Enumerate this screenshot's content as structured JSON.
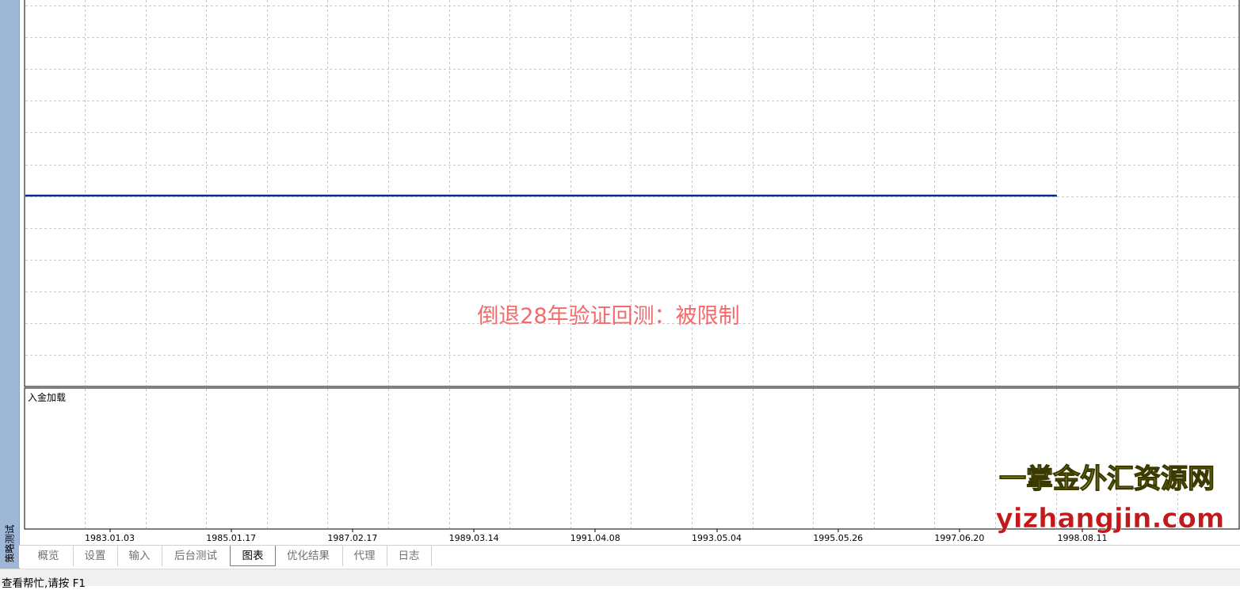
{
  "window": {
    "side_title": "策略测试"
  },
  "chart": {
    "overlay_text": "倒退28年验证回测：被限制",
    "subpanel_label": "入金加载",
    "watermark_cn": "一掌金外汇资源网",
    "watermark_url": "yizhangjin.com",
    "line_color": "#0a2a8a",
    "overlay_color": "#f26a6a",
    "watermark_fill": "#e9f23c"
  },
  "chart_data": {
    "type": "line",
    "x_tick_labels": [
      "1983.01.03",
      "1985.01.17",
      "1987.02.17",
      "1989.03.14",
      "1991.04.08",
      "1993.05.04",
      "1995.05.26",
      "1997.06.20",
      "1998.08.11"
    ],
    "series": [
      {
        "x": [
          "1983.01.03",
          "1998.08.11"
        ],
        "y": [
          1,
          1
        ]
      }
    ],
    "grid": true
  },
  "tabs": [
    {
      "label": "概览",
      "active": false
    },
    {
      "label": "设置",
      "active": false
    },
    {
      "label": "输入",
      "active": false
    },
    {
      "label": "后台测试",
      "active": false
    },
    {
      "label": "图表",
      "active": true
    },
    {
      "label": "优化结果",
      "active": false
    },
    {
      "label": "代理",
      "active": false
    },
    {
      "label": "日志",
      "active": false
    }
  ],
  "status": {
    "text": "查看帮忙,请按 F1"
  }
}
